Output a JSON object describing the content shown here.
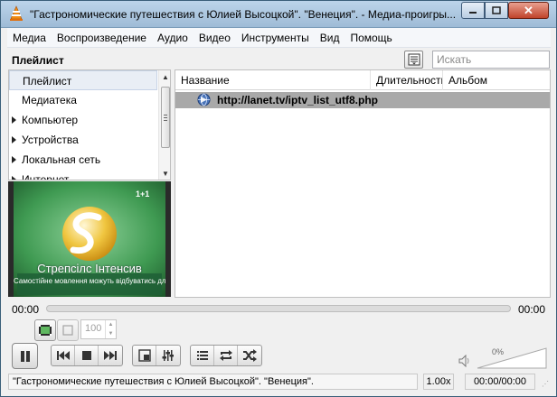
{
  "window": {
    "title": "\"Гастрономические путешествия с Юлией Высоцкой\". \"Венеция\". - Медиа-проигры..."
  },
  "menu": {
    "items": [
      "Медиа",
      "Воспроизведение",
      "Аудио",
      "Видео",
      "Инструменты",
      "Вид",
      "Помощь"
    ]
  },
  "playlist": {
    "heading": "Плейлист",
    "search_placeholder": "Искать",
    "tree": [
      {
        "label": "Плейлист",
        "expandable": false,
        "selected": true
      },
      {
        "label": "Медиатека",
        "expandable": false,
        "selected": false
      },
      {
        "label": "Компьютер",
        "expandable": true,
        "selected": false
      },
      {
        "label": "Устройства",
        "expandable": true,
        "selected": false
      },
      {
        "label": "Локальная сеть",
        "expandable": true,
        "selected": false
      },
      {
        "label": "Интернет",
        "expandable": true,
        "selected": false
      }
    ],
    "columns": [
      "Название",
      "Длительность",
      "Альбом"
    ],
    "rows": [
      {
        "title": "http://lanet.tv/iptv_list_utf8.php",
        "duration": "",
        "album": ""
      }
    ]
  },
  "video_preview": {
    "caption": "Стрепсілс Інтенсив",
    "subtitle": "Самостійне мовлення можуть відбуватись для вашого здоров'я",
    "channel_logo": "1+1"
  },
  "playback": {
    "elapsed": "00:00",
    "total": "00:00",
    "speed_field": "100"
  },
  "volume": {
    "percent_label": "0%"
  },
  "status_bar": {
    "now_playing": "\"Гастрономические путешествия с Юлией Высоцкой\". \"Венеция\".",
    "speed": "1.00x",
    "time": "00:00/00:00"
  },
  "colors": {
    "titlebar": "#bcd4ea",
    "selected_row": "#a9a9a9",
    "vlc_orange": "#f08c14"
  }
}
